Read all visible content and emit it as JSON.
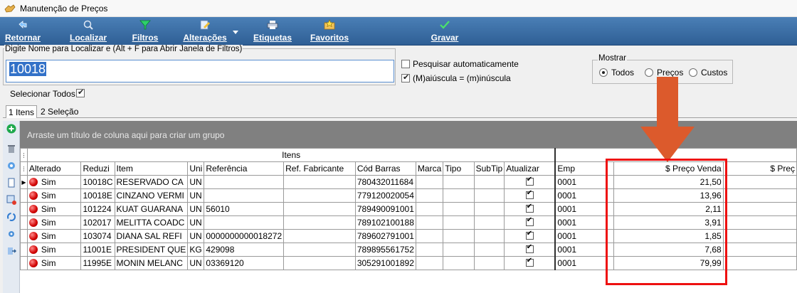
{
  "window": {
    "title": "Manutenção de Preços"
  },
  "toolbar": {
    "buttons": [
      {
        "label": "Retornar",
        "icon": "back-arrow-icon"
      },
      {
        "label": "Localizar",
        "icon": "magnifier-icon"
      },
      {
        "label": "Filtros",
        "icon": "funnel-icon"
      },
      {
        "label": "Alterações",
        "icon": "edit-document-icon"
      },
      {
        "label": "Etiquetas",
        "icon": "printer-icon"
      },
      {
        "label": "Favoritos",
        "icon": "star-folder-icon"
      },
      {
        "label": "Gravar",
        "icon": "checkmark-icon"
      }
    ]
  },
  "search": {
    "legend": "Digite Nome para Localizar e (Alt + F para Abrir Janela de Filtros)",
    "value": "10018",
    "auto_search_label": "Pesquisar automaticamente",
    "auto_search_checked": false,
    "case_label": "(M)aiúscula = (m)inúscula",
    "case_checked": true
  },
  "mostrar": {
    "legend": "Mostrar",
    "options": [
      "Todos",
      "Preços",
      "Custos"
    ],
    "selected": "Todos"
  },
  "select_all_label": "Selecionar Todos",
  "tabs": [
    "1 Itens",
    "2 Seleção"
  ],
  "group_panel_text": "Arraste um título de coluna aqui para criar um grupo",
  "grid": {
    "band_left": "Itens",
    "columns": [
      "Alterado",
      "Reduzi",
      "Item",
      "Uni",
      "Referência",
      "Ref. Fabricante",
      "Cód Barras",
      "Marca",
      "Tipo",
      "SubTip",
      "Atualizar",
      "Emp",
      "$ Preço Venda",
      "$ Preç"
    ],
    "rows": [
      {
        "alterado": "Sim",
        "reduzido": "10018C",
        "item": "RESERVADO CA",
        "un": "UN",
        "referencia": "",
        "ref_fab": "",
        "cod_barras": "780432011684",
        "emp": "0001",
        "preco_venda": "21,50"
      },
      {
        "alterado": "Sim",
        "reduzido": "10018E",
        "item": "CINZANO VERMI",
        "un": "UN",
        "referencia": "",
        "ref_fab": "",
        "cod_barras": "779120020054",
        "emp": "0001",
        "preco_venda": "13,96"
      },
      {
        "alterado": "Sim",
        "reduzido": "101224",
        "item": "KUAT GUARANA",
        "un": "UN",
        "referencia": "56010",
        "ref_fab": "",
        "cod_barras": "789490091001",
        "emp": "0001",
        "preco_venda": "2,11"
      },
      {
        "alterado": "Sim",
        "reduzido": "102017",
        "item": "MELITTA COADC",
        "un": "UN",
        "referencia": "",
        "ref_fab": "",
        "cod_barras": "789102100188",
        "emp": "0001",
        "preco_venda": "3,91"
      },
      {
        "alterado": "Sim",
        "reduzido": "103074",
        "item": "DIANA SAL REFI",
        "un": "UN",
        "referencia": "0000000000018272",
        "ref_fab": "",
        "cod_barras": "789602791001",
        "emp": "0001",
        "preco_venda": "1,85"
      },
      {
        "alterado": "Sim",
        "reduzido": "11001E",
        "item": "PRESIDENT QUE",
        "un": "KG",
        "referencia": "429098",
        "ref_fab": "",
        "cod_barras": "789895561752",
        "emp": "0001",
        "preco_venda": "7,68"
      },
      {
        "alterado": "Sim",
        "reduzido": "11995E",
        "item": "MONIN MELANC",
        "un": "UN",
        "referencia": "03369120",
        "ref_fab": "",
        "cod_barras": "305291001892",
        "emp": "0001",
        "preco_venda": "79,99"
      }
    ]
  },
  "colors": {
    "toolbar": "#2f5f95",
    "annotation": "#ee1010",
    "arrow": "#dc5a2c",
    "group_panel": "#808080"
  }
}
